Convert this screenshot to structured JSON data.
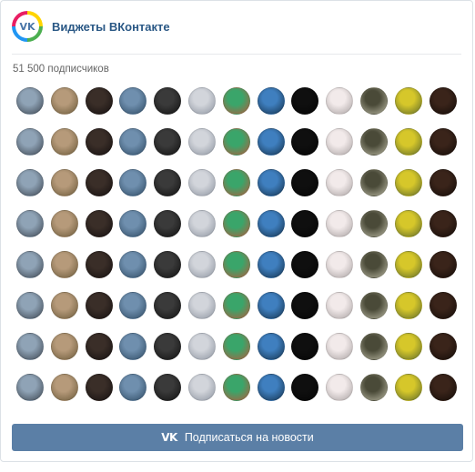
{
  "header": {
    "title": "Виджеты ВКонтакте",
    "logo_glyph": "VK"
  },
  "subscribers_text": "51 500 подписчиков",
  "subscribe_button": {
    "label": "Подписаться на новости",
    "icon_glyph": "VK"
  },
  "avatar_grid": {
    "columns": 13,
    "rows": 8,
    "column_palette": [
      [
        "#8fa3b6",
        "#3c4550"
      ],
      [
        "#b69a7a",
        "#6b5a3a"
      ],
      [
        "#3a2e28",
        "#151010"
      ],
      [
        "#6f8fae",
        "#2e4a63"
      ],
      [
        "#3a3a3a",
        "#111111"
      ],
      [
        "#d2d5db",
        "#8d94a0"
      ],
      [
        "#3aa56a",
        "#b55a3c"
      ],
      [
        "#3f7fbf",
        "#14324d"
      ],
      [
        "#0f0f0f",
        "#050505"
      ],
      [
        "#f2eaea",
        "#a8a1a1"
      ],
      [
        "#4a4a38",
        "#b9b7a2"
      ],
      [
        "#d6c72a",
        "#5f6a2a"
      ],
      [
        "#3a241a",
        "#140c08"
      ]
    ]
  }
}
